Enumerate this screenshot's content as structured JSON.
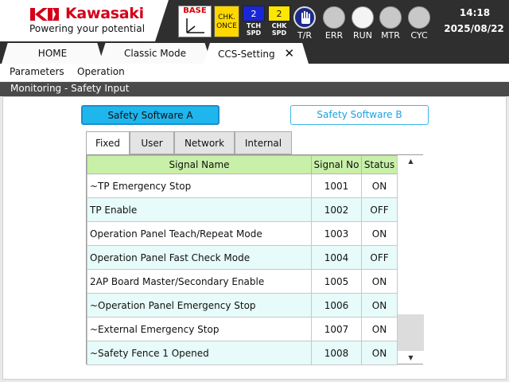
{
  "header": {
    "logo_text": "Kawasaki",
    "tagline": "Powering your potential",
    "base_label": "BASE",
    "chk_once_label": "CHK.\nONCE",
    "tch_spd": {
      "value": "2",
      "label": "TCH\nSPD",
      "color": "#1a27d6"
    },
    "chk_spd": {
      "value": "2",
      "label": "CHK\nSPD",
      "color": "#ffe600"
    },
    "tr_label": "T/R",
    "lamps": [
      {
        "label": "ERR",
        "on": false
      },
      {
        "label": "RUN",
        "on": true
      },
      {
        "label": "MTR",
        "on": false
      },
      {
        "label": "CYC",
        "on": false
      }
    ],
    "time": "14:18",
    "date": "2025/08/22",
    "brand_color": "#d4001a"
  },
  "tabs": [
    {
      "label": "HOME"
    },
    {
      "label": "Classic Mode"
    },
    {
      "label": "CCS-Setting",
      "close": "✕",
      "active": true
    }
  ],
  "menu": {
    "parameters": "Parameters",
    "operation": "Operation"
  },
  "page_title": "Monitoring - Safety Input",
  "software_buttons": {
    "a": "Safety Software A",
    "b": "Safety Software B",
    "selected": "a"
  },
  "subtabs": [
    {
      "label": "Fixed",
      "active": true
    },
    {
      "label": "User"
    },
    {
      "label": "Network"
    },
    {
      "label": "Internal"
    }
  ],
  "table": {
    "headers": {
      "name": "Signal Name",
      "no": "Signal No",
      "status": "Status"
    },
    "rows": [
      {
        "name": "~TP Emergency Stop",
        "no": "1001",
        "status": "ON"
      },
      {
        "name": "TP Enable",
        "no": "1002",
        "status": "OFF"
      },
      {
        "name": "Operation Panel Teach/Repeat Mode",
        "no": "1003",
        "status": "ON"
      },
      {
        "name": "Operation Panel Fast Check Mode",
        "no": "1004",
        "status": "OFF"
      },
      {
        "name": "2AP Board Master/Secondary Enable",
        "no": "1005",
        "status": "ON"
      },
      {
        "name": "~Operation Panel Emergency Stop",
        "no": "1006",
        "status": "ON"
      },
      {
        "name": "~External Emergency Stop",
        "no": "1007",
        "status": "ON"
      },
      {
        "name": "~Safety Fence 1 Opened",
        "no": "1008",
        "status": "ON"
      }
    ],
    "scroll_up_icon": "▲",
    "scroll_down_icon": "▼"
  }
}
